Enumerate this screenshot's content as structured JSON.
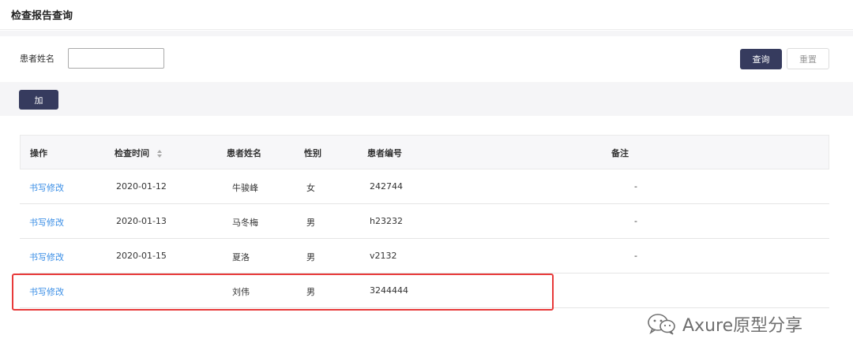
{
  "page": {
    "title": "检查报告查询"
  },
  "search": {
    "label": "患者姓名",
    "value": "",
    "placeholder": "",
    "query_label": "查询",
    "reset_label": "重置"
  },
  "actions": {
    "add_label": "加"
  },
  "table": {
    "headers": {
      "op": "操作",
      "time": "检查时间",
      "name": "患者姓名",
      "gender": "性别",
      "id": "患者编号",
      "note": "备注"
    },
    "rows": [
      {
        "op": "书写修改",
        "time": "2020-01-12",
        "name": "牛骏峰",
        "gender": "女",
        "id": "242744",
        "note": "-"
      },
      {
        "op": "书写修改",
        "time": "2020-01-13",
        "name": "马冬梅",
        "gender": "男",
        "id": "h23232",
        "note": "-"
      },
      {
        "op": "书写修改",
        "time": "2020-01-15",
        "name": "夏洛",
        "gender": "男",
        "id": "v2132",
        "note": "-"
      },
      {
        "op": "书写修改",
        "time": "",
        "name": "刘伟",
        "gender": "男",
        "id": "3244444",
        "note": ""
      }
    ]
  },
  "watermark": {
    "text": "Axure原型分享",
    "icon": "wechat-icon"
  },
  "colors": {
    "primary": "#363b5e",
    "link": "#3a8ee6",
    "highlight": "#e83a3a"
  }
}
